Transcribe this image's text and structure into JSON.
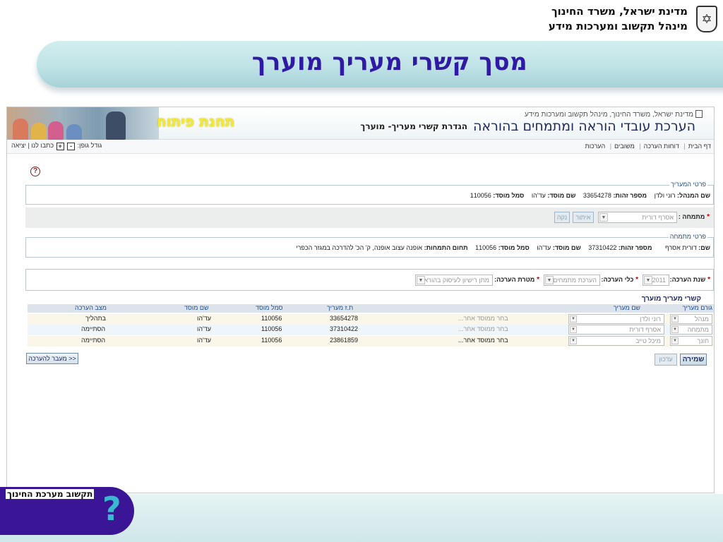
{
  "slide": {
    "ministry_line1": "מדינת ישראל, משרד החינוך",
    "ministry_line2": "מינהל תקשוב ומערכות מידע",
    "title": "מסך קשרי מעריך מוערך",
    "footer_text": "תקשוב מערכת החינוך"
  },
  "app": {
    "dev_station": "תחנת פיתוח",
    "org_line": "מדינת ישראל, משרד החינוך, מינהל תקשוב ומערכות מידע",
    "title": "הערכת עובדי הוראה ומתמחים בהוראה",
    "subtitle": "הגדרת קשרי מעריך- מוערך",
    "nav": [
      "דף הבית",
      "דוחות הערכה",
      "משובים",
      "הערכות"
    ],
    "font_size_label": "גודל גופן:",
    "font_plus": "+",
    "font_minus": "-",
    "contact_label": "כתבו לנו",
    "exit_label": "יציאה",
    "help_glyph": "?"
  },
  "evaluator": {
    "legend": "פרטי המעריך",
    "name_label": "שם המנהל:",
    "name_value": "רוני ולדן",
    "id_label": "מספר זהות:",
    "id_value": "33654278",
    "school_name_label": "שם מוסד:",
    "school_name_value": "עד'הו",
    "school_code_label": "סמל מוסד:",
    "school_code_value": "110056"
  },
  "intern_select": {
    "label": "מתמחה :",
    "value": "אסרף דורית",
    "search_btn": "איתור",
    "clear_btn": "נקה"
  },
  "intern": {
    "legend": "פרטי מתמחה",
    "name_label": "שם:",
    "name_value": "דורית אסרף",
    "id_label": "מספר זהות:",
    "id_value": "37310422",
    "school_name_label": "שם מוסד:",
    "school_name_value": "עד'הו",
    "school_code_label": "סמל מוסד:",
    "school_code_value": "110056",
    "field_label": "תחום התמחות:",
    "field_value": "אופנה עצוב אופנה, ק' הכ' להדרכה במגזר הכפרי"
  },
  "evaluation": {
    "year_label": "שנת הערכה:",
    "year_value": "2011",
    "tool_label": "כלי הערכה:",
    "tool_value": "הערכת מתמחים",
    "purpose_label": "מטרת הערכה:",
    "purpose_value": "מתן רישיון לעיסוק בהוראה"
  },
  "relations": {
    "section_title": "קשרי מעריך מוערך",
    "columns": {
      "role": "גורם מעריך",
      "evaluator": "שם מעריך",
      "id": "ת.ז מעריך",
      "code": "סמל מוסד",
      "school": "שם מוסד",
      "status": "מצב הערכה"
    },
    "rows": [
      {
        "role": "מנהל",
        "evaluator": "רוני ולדן",
        "other_school": "בחר ממוסד אחר...",
        "id": "33654278",
        "code": "110056",
        "school": "עד'הו",
        "status": "בתהליך"
      },
      {
        "role": "מתמחה",
        "evaluator": "אסרף דורית",
        "other_school": "בחר ממוסד אחר...",
        "id": "37310422",
        "code": "110056",
        "school": "עד'הו",
        "status": "הסתיימה"
      },
      {
        "role": "חונך",
        "evaluator": "מיכל טייב",
        "other_school": "בחר ממוסד אחר...",
        "id": "23861859",
        "code": "110056",
        "school": "עד'הו",
        "status": "הסתיימה"
      }
    ],
    "save_btn": "שמירה",
    "update_btn": "עדכון",
    "transfer_btn": "מעבר להערכה >>"
  },
  "icons": {
    "emblem": "menorah-emblem-icon",
    "help": "question-circle-icon",
    "dropdown": "chevron-down-icon"
  },
  "colors": {
    "title_text": "#2f1aa3",
    "title_band": "#bfe3e6",
    "footer_logo": "#3a1596",
    "dev_station": "#f2e83a",
    "grid_header": "#dde3ea"
  }
}
